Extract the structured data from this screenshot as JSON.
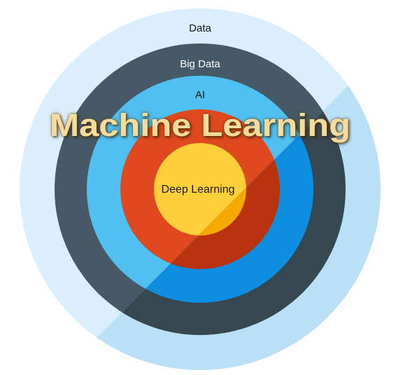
{
  "rings": [
    {
      "id": "data",
      "label": "Data",
      "color": "#daeefb",
      "shade": "#b9e0f7",
      "text_color": "#1a1a1a"
    },
    {
      "id": "big-data",
      "label": "Big Data",
      "color": "#455a66",
      "shade": "#37474f",
      "text_color": "#ffffff"
    },
    {
      "id": "ai",
      "label": "AI",
      "color": "#4fc0f0",
      "shade": "#0d8ee0",
      "text_color": "#1a1a1a"
    },
    {
      "id": "machine-learning",
      "label": "Machine Learning",
      "color": "#e0491e",
      "shade": "#b9330f",
      "text_color": "#f6dc9c"
    },
    {
      "id": "deep-learning",
      "label": "Deep Learning",
      "color": "#ffcf3a",
      "shade": "#f6aa00",
      "text_color": "#1a1a1a"
    }
  ]
}
